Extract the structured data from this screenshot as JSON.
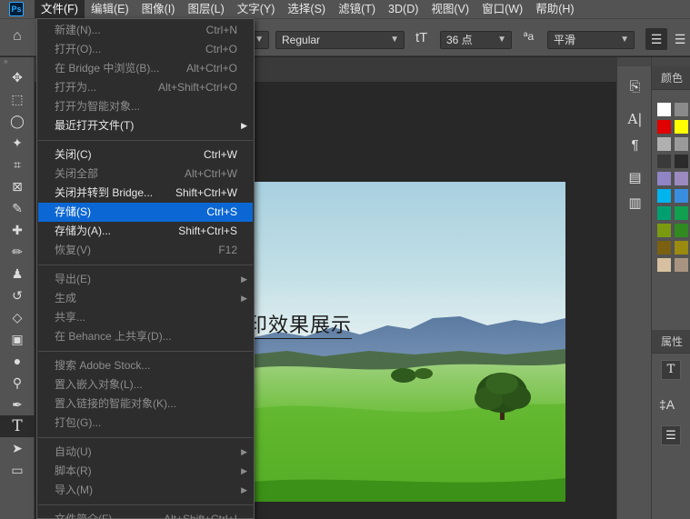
{
  "menubar": {
    "logo": "Ps",
    "items": [
      "文件(F)",
      "编辑(E)",
      "图像(I)",
      "图层(L)",
      "文字(Y)",
      "选择(S)",
      "滤镜(T)",
      "3D(D)",
      "视图(V)",
      "窗口(W)",
      "帮助(H)"
    ],
    "active_index": 0
  },
  "options": {
    "font_style": "Regular",
    "font_size": "36 点",
    "antialias": "平滑",
    "size_icon": "tT",
    "aa_icon": "ªa"
  },
  "canvas_text": "印效果展示",
  "file_menu": [
    {
      "label": "新建(N)...",
      "shortcut": "Ctrl+N",
      "state": "disabled"
    },
    {
      "label": "打开(O)...",
      "shortcut": "Ctrl+O",
      "state": "disabled"
    },
    {
      "label": "在 Bridge 中浏览(B)...",
      "shortcut": "Alt+Ctrl+O",
      "state": "disabled"
    },
    {
      "label": "打开为...",
      "shortcut": "Alt+Shift+Ctrl+O",
      "state": "disabled"
    },
    {
      "label": "打开为智能对象...",
      "shortcut": "",
      "state": "disabled"
    },
    {
      "label": "最近打开文件(T)",
      "shortcut": "",
      "state": "enabled",
      "submenu": true
    },
    {
      "label": "关闭(C)",
      "shortcut": "Ctrl+W",
      "state": "enabled"
    },
    {
      "label": "关闭全部",
      "shortcut": "Alt+Ctrl+W",
      "state": "disabled"
    },
    {
      "label": "关闭并转到 Bridge...",
      "shortcut": "Shift+Ctrl+W",
      "state": "enabled"
    },
    {
      "label": "存储(S)",
      "shortcut": "Ctrl+S",
      "state": "highlighted"
    },
    {
      "label": "存储为(A)...",
      "shortcut": "Shift+Ctrl+S",
      "state": "enabled"
    },
    {
      "label": "恢复(V)",
      "shortcut": "F12",
      "state": "disabled"
    },
    {
      "label": "导出(E)",
      "shortcut": "",
      "state": "disabled",
      "submenu": true
    },
    {
      "label": "生成",
      "shortcut": "",
      "state": "disabled",
      "submenu": true
    },
    {
      "label": "共享...",
      "shortcut": "",
      "state": "disabled"
    },
    {
      "label": "在 Behance 上共享(D)...",
      "shortcut": "",
      "state": "disabled"
    },
    {
      "label": "搜索 Adobe Stock...",
      "shortcut": "",
      "state": "disabled"
    },
    {
      "label": "置入嵌入对象(L)...",
      "shortcut": "",
      "state": "disabled"
    },
    {
      "label": "置入链接的智能对象(K)...",
      "shortcut": "",
      "state": "disabled"
    },
    {
      "label": "打包(G)...",
      "shortcut": "",
      "state": "disabled"
    },
    {
      "label": "自动(U)",
      "shortcut": "",
      "state": "disabled",
      "submenu": true
    },
    {
      "label": "脚本(R)",
      "shortcut": "",
      "state": "disabled",
      "submenu": true
    },
    {
      "label": "导入(M)",
      "shortcut": "",
      "state": "disabled",
      "submenu": true
    },
    {
      "label": "文件简介(F)...",
      "shortcut": "Alt+Shift+Ctrl+I",
      "state": "disabled"
    }
  ],
  "panels": {
    "swatches_tab": "颜色",
    "properties_tab": "属性",
    "swatch_colors": [
      "#ffffff",
      "#8a8a8a",
      "#8a8a8a",
      "#e00000",
      "#ffff00",
      "#00cc00",
      "#b0b0b0",
      "#9a9a9a",
      "#bdbdbd",
      "#3a3a3a",
      "#2b2b2b",
      "#202020",
      "#8f84c4",
      "#9a8ac0",
      "#a4a0cc",
      "#00b4ee",
      "#3a8ee0",
      "#5a8ae0",
      "#00a070",
      "#10a050",
      "#30b050",
      "#7a9a10",
      "#308a20",
      "#40a030",
      "#7a6010",
      "#9a8a10",
      "#a0a030",
      "#d6c0a0",
      "#a89480",
      "#c0b0a0"
    ]
  }
}
